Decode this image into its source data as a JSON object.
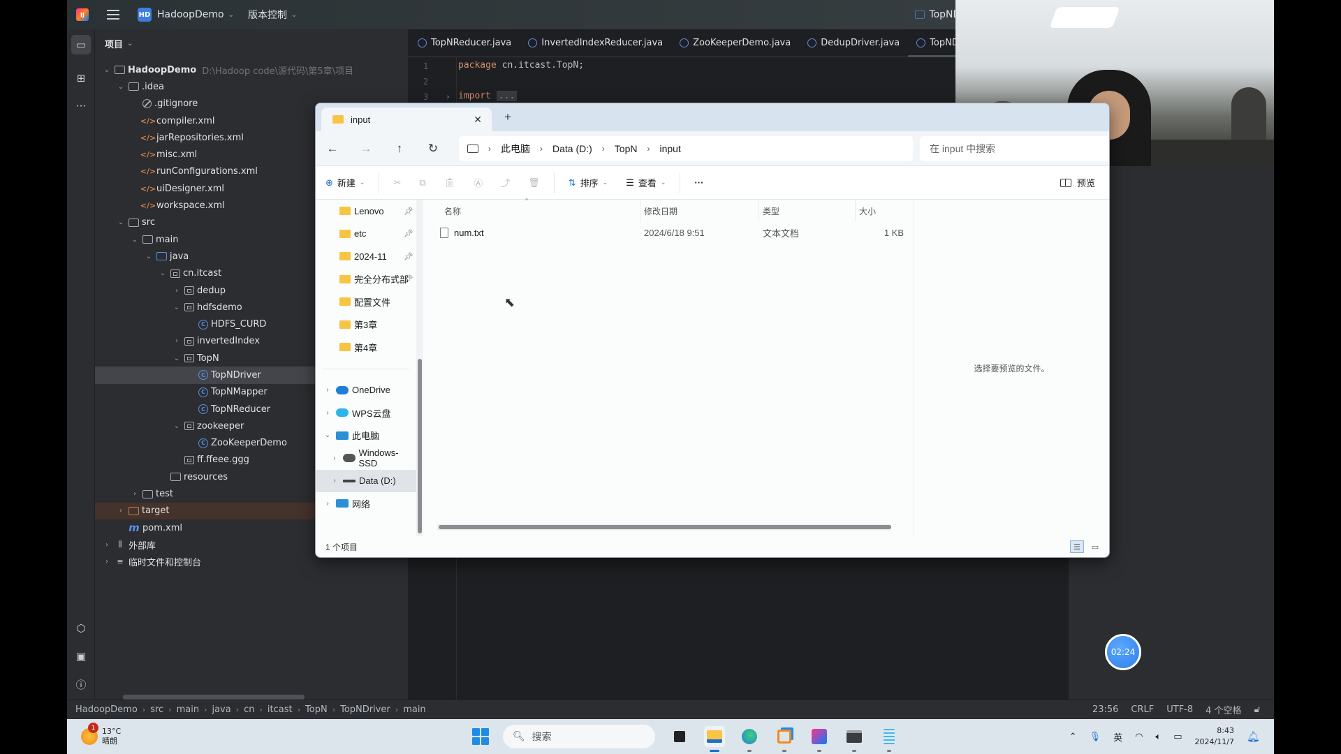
{
  "ide": {
    "project_name": "HadoopDemo",
    "project_badge": "HD",
    "vcs_menu": "版本控制",
    "run_config": "TopNDriver",
    "panel_title": "项目",
    "tree": [
      {
        "label": "HadoopDemo",
        "path": "D:\\Hadoop code\\源代码\\第5章\\项目",
        "indent": 0,
        "twisty": "v",
        "icon": "module-folder",
        "bold": true
      },
      {
        "label": ".idea",
        "indent": 1,
        "twisty": "v",
        "icon": "folder"
      },
      {
        "label": ".gitignore",
        "indent": 2,
        "twisty": "",
        "icon": "ignore"
      },
      {
        "label": "compiler.xml",
        "indent": 2,
        "twisty": "",
        "icon": "xml"
      },
      {
        "label": "jarRepositories.xml",
        "indent": 2,
        "twisty": "",
        "icon": "xml"
      },
      {
        "label": "misc.xml",
        "indent": 2,
        "twisty": "",
        "icon": "xml"
      },
      {
        "label": "runConfigurations.xml",
        "indent": 2,
        "twisty": "",
        "icon": "xml"
      },
      {
        "label": "uiDesigner.xml",
        "indent": 2,
        "twisty": "",
        "icon": "xml"
      },
      {
        "label": "workspace.xml",
        "indent": 2,
        "twisty": "",
        "icon": "xml"
      },
      {
        "label": "src",
        "indent": 1,
        "twisty": "v",
        "icon": "folder"
      },
      {
        "label": "main",
        "indent": 2,
        "twisty": "v",
        "icon": "folder"
      },
      {
        "label": "java",
        "indent": 3,
        "twisty": "v",
        "icon": "folder-blue"
      },
      {
        "label": "cn.itcast",
        "indent": 4,
        "twisty": "v",
        "icon": "package"
      },
      {
        "label": "dedup",
        "indent": 5,
        "twisty": ">",
        "icon": "package"
      },
      {
        "label": "hdfsdemo",
        "indent": 5,
        "twisty": "v",
        "icon": "package"
      },
      {
        "label": "HDFS_CURD",
        "indent": 6,
        "twisty": "",
        "icon": "class"
      },
      {
        "label": "invertedIndex",
        "indent": 5,
        "twisty": ">",
        "icon": "package"
      },
      {
        "label": "TopN",
        "indent": 5,
        "twisty": "v",
        "icon": "package"
      },
      {
        "label": "TopNDriver",
        "indent": 6,
        "twisty": "",
        "icon": "class",
        "selected": true
      },
      {
        "label": "TopNMapper",
        "indent": 6,
        "twisty": "",
        "icon": "class"
      },
      {
        "label": "TopNReducer",
        "indent": 6,
        "twisty": "",
        "icon": "class"
      },
      {
        "label": "zookeeper",
        "indent": 5,
        "twisty": "v",
        "icon": "package"
      },
      {
        "label": "ZooKeeperDemo",
        "indent": 6,
        "twisty": "",
        "icon": "class"
      },
      {
        "label": "ff.ffeee.ggg",
        "indent": 5,
        "twisty": "",
        "icon": "package"
      },
      {
        "label": "resources",
        "indent": 4,
        "twisty": "",
        "icon": "resources"
      },
      {
        "label": "test",
        "indent": 2,
        "twisty": ">",
        "icon": "folder"
      },
      {
        "label": "target",
        "indent": 1,
        "twisty": ">",
        "icon": "folder-brown",
        "excluded": true
      },
      {
        "label": "pom.xml",
        "indent": 1,
        "twisty": "",
        "icon": "maven"
      },
      {
        "label": "外部库",
        "indent": 0,
        "twisty": ">",
        "icon": "library"
      },
      {
        "label": "临时文件和控制台",
        "indent": 0,
        "twisty": ">",
        "icon": "scratches"
      }
    ],
    "tabs": [
      {
        "label": "TopNReducer.java",
        "active": false
      },
      {
        "label": "InvertedIndexReducer.java",
        "active": false
      },
      {
        "label": "ZooKeeperDemo.java",
        "active": false
      },
      {
        "label": "DedupDriver.java",
        "active": false
      },
      {
        "label": "TopNDriver.java",
        "active": true
      }
    ],
    "code": {
      "lines": [
        "1",
        "2",
        "3"
      ],
      "line1_kw": "package",
      "line1_rest": " cn.itcast.TopN;",
      "line3_kw": "import",
      "line3_fold": "..."
    },
    "breadcrumb": [
      "HadoopDemo",
      "src",
      "main",
      "java",
      "cn",
      "itcast",
      "TopN",
      "TopNDriver",
      "main"
    ],
    "status": {
      "position": "23:56",
      "line_ending": "CRLF",
      "encoding": "UTF-8",
      "indent": "4 个空格"
    }
  },
  "explorer": {
    "tab_title": "input",
    "address": [
      "此电脑",
      "Data (D:)",
      "TopN",
      "input"
    ],
    "search_placeholder": "在 input 中搜索",
    "commands": {
      "new": "新建",
      "sort": "排序",
      "view": "查看",
      "more": "···",
      "preview": "预览"
    },
    "quick_access": [
      {
        "label": "Lenovo",
        "pinned": true
      },
      {
        "label": "etc",
        "pinned": true
      },
      {
        "label": "2024-11",
        "pinned": true
      },
      {
        "label": "完全分布式部",
        "pinned": true
      },
      {
        "label": "配置文件",
        "pinned": false
      },
      {
        "label": "第3章",
        "pinned": false
      },
      {
        "label": "第4章",
        "pinned": false
      }
    ],
    "locations": [
      {
        "label": "OneDrive",
        "twisty": ">",
        "indent": 0,
        "icon": "cloud-blue"
      },
      {
        "label": "WPS云盘",
        "twisty": ">",
        "indent": 0,
        "icon": "cloud-teal"
      },
      {
        "label": "此电脑",
        "twisty": "v",
        "indent": 0,
        "icon": "pc"
      },
      {
        "label": "Windows-SSD",
        "twisty": ">",
        "indent": 1,
        "icon": "drive-win"
      },
      {
        "label": "Data (D:)",
        "twisty": ">",
        "indent": 1,
        "icon": "drive",
        "selected": true
      },
      {
        "label": "网络",
        "twisty": ">",
        "indent": 0,
        "icon": "network"
      }
    ],
    "columns": [
      "名称",
      "修改日期",
      "类型",
      "大小"
    ],
    "files": [
      {
        "name": "num.txt",
        "modified": "2024/6/18 9:51",
        "type": "文本文档",
        "size": "1 KB"
      }
    ],
    "preview_hint": "选择要预览的文件。",
    "item_count": "1 个项目"
  },
  "overlay": {
    "timer": "02:24"
  },
  "taskbar": {
    "weather_temp": "13°C",
    "weather_desc": "晴朗",
    "weather_badge": "1",
    "search_placeholder": "搜索",
    "ime": "英",
    "time": "8:43",
    "date": "2024/11/7"
  }
}
